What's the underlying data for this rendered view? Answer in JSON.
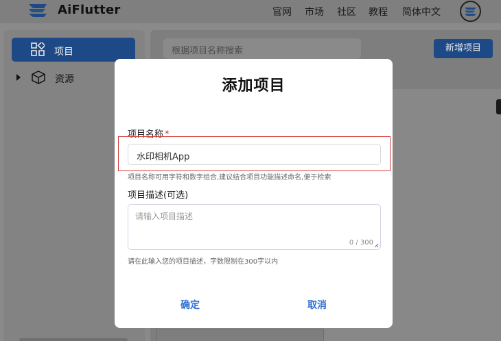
{
  "header": {
    "brand": "AiFlutter",
    "nav": [
      "官网",
      "市场",
      "社区",
      "教程",
      "简体中文"
    ]
  },
  "sidebar": {
    "items": [
      {
        "label": "项目",
        "icon": "grid-icon",
        "active": true
      },
      {
        "label": "资源",
        "icon": "cube-icon",
        "active": false
      }
    ]
  },
  "main": {
    "search_placeholder": "根据项目名称搜索",
    "add_button": "新增项目"
  },
  "modal": {
    "title": "添加项目",
    "name_label": "项目名称",
    "required_mark": "*",
    "name_value": "水印相机App",
    "name_hint": "项目名称可用字符和数字组合,建议结合项目功能描述命名,便于检索",
    "desc_label": "项目描述(可选)",
    "desc_placeholder": "请输入项目描述",
    "desc_counter": "0 / 300",
    "desc_hint": "请在此输入您的项目描述，字数限制在300字以内",
    "confirm": "确定",
    "cancel": "取消"
  },
  "colors": {
    "accent": "#2d6fd1",
    "highlight": "#d23a3a",
    "overlay": "#7f7f7f"
  }
}
